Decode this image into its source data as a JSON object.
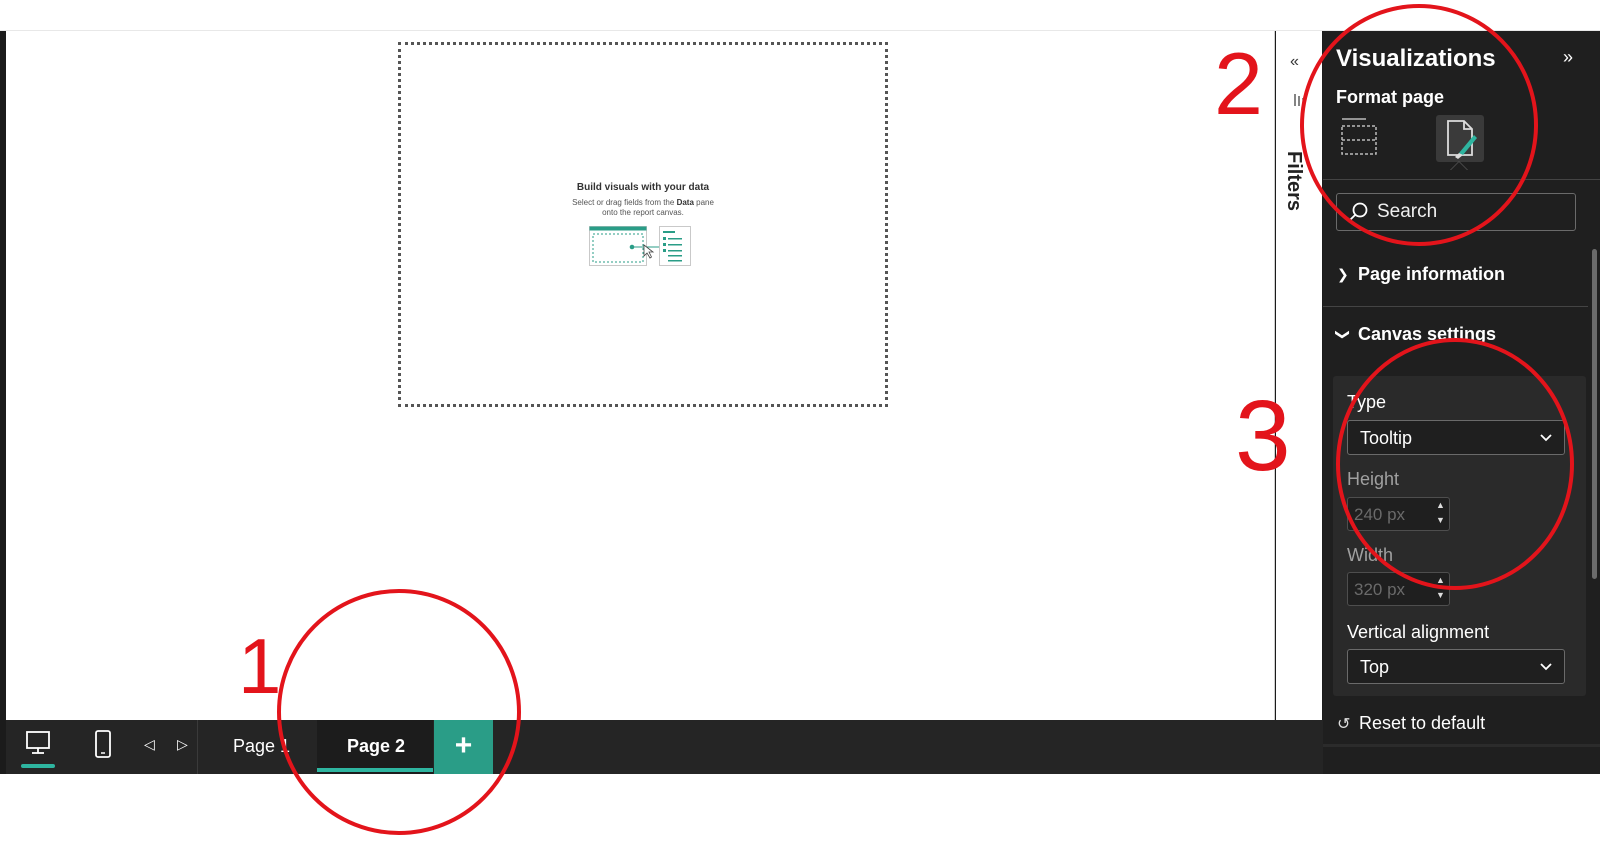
{
  "canvas": {
    "placeholder_title": "Build visuals with your data",
    "placeholder_line1_pre": "Select or drag fields from the ",
    "placeholder_line1_bold": "Data",
    "placeholder_line1_post": " pane",
    "placeholder_line2": "onto the report canvas."
  },
  "filters": {
    "label": "Filters",
    "collapse_icon": "double-chevron-left-icon",
    "filter_icon": "filter-lines-icon"
  },
  "pane": {
    "title": "Visualizations",
    "expand_icon": "double-chevron-right-icon",
    "subtitle": "Format page",
    "tabs": [
      {
        "icon": "visual-layout-icon"
      },
      {
        "icon": "format-paintbrush-icon",
        "selected": true
      }
    ],
    "search_placeholder": "Search",
    "sections": {
      "page_information": {
        "label": "Page information",
        "expanded": false
      },
      "canvas_settings": {
        "label": "Canvas settings",
        "expanded": true
      }
    },
    "canvas_settings": {
      "type_label": "Type",
      "type_value": "Tooltip",
      "height_label": "Height",
      "height_value": "240 px",
      "width_label": "Width",
      "width_value": "320 px",
      "valign_label": "Vertical alignment",
      "valign_value": "Top"
    },
    "reset_label": "Reset to default"
  },
  "bottombar": {
    "desktop_icon": "desktop-layout-icon",
    "phone_icon": "mobile-layout-icon",
    "prev_icon": "caret-left-icon",
    "next_icon": "caret-right-icon",
    "pages": [
      "Page 1",
      "Page 2"
    ],
    "active_page": "Page 2",
    "add_label": "+"
  },
  "annotations": {
    "labels": [
      "1",
      "2",
      "3"
    ],
    "color": "#e3141b"
  },
  "colors": {
    "accent": "#2eb5a0",
    "add_button": "#2a9d87",
    "pane_bg": "#1f1f1f"
  }
}
